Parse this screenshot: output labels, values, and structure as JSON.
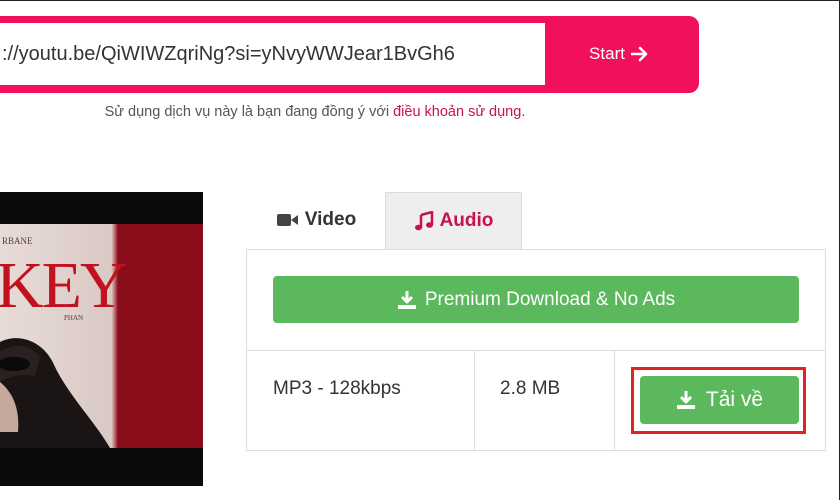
{
  "search": {
    "url_value": "://youtu.be/QiWIWZqriNg?si=yNvyWWJear1BvGh6",
    "start_label": "Start"
  },
  "terms": {
    "text": "Sử dụng dịch vụ này là bạn đang đồng ý với ",
    "link": "điều khoản sử dụng",
    "suffix": "."
  },
  "thumbnail": {
    "title_text": "KEY",
    "top_text": "RBANE",
    "side_text": "PHAN"
  },
  "tabs": [
    {
      "label": "Video",
      "icon": "video-camera-icon",
      "active": false
    },
    {
      "label": "Audio",
      "icon": "music-note-icon",
      "active": true
    }
  ],
  "premium": {
    "label": "Premium Download & No Ads"
  },
  "audio_row": {
    "format": "MP3 - 128kbps",
    "size": "2.8 MB",
    "download_label": "Tải về"
  },
  "colors": {
    "brand": "#f0115a",
    "accent_text": "#c8114f",
    "success": "#5cb85c",
    "highlight": "#e02424"
  }
}
